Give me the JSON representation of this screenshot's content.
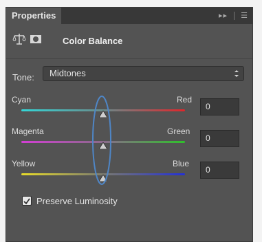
{
  "panel": {
    "tab_label": "Properties",
    "expand_glyph": "▸▸",
    "menu_glyph": "☰",
    "title": "Color Balance",
    "header_icons": [
      "color-balance-icon",
      "layer-mask-icon"
    ]
  },
  "tone": {
    "label": "Tone:",
    "selected": "Midtones"
  },
  "sliders": {
    "cyan_red": {
      "left_label": "Cyan",
      "right_label": "Red",
      "value": "0",
      "position_fraction": 0.5
    },
    "magenta_green": {
      "left_label": "Magenta",
      "right_label": "Green",
      "value": "0",
      "position_fraction": 0.5
    },
    "yellow_blue": {
      "left_label": "Yellow",
      "right_label": "Blue",
      "value": "0",
      "position_fraction": 0.5
    }
  },
  "preserve_luminosity": {
    "label": "Preserve Luminosity",
    "checked": true
  },
  "colors": {
    "panel_bg": "#535353",
    "annotation_ellipse": "#4f86c6"
  }
}
